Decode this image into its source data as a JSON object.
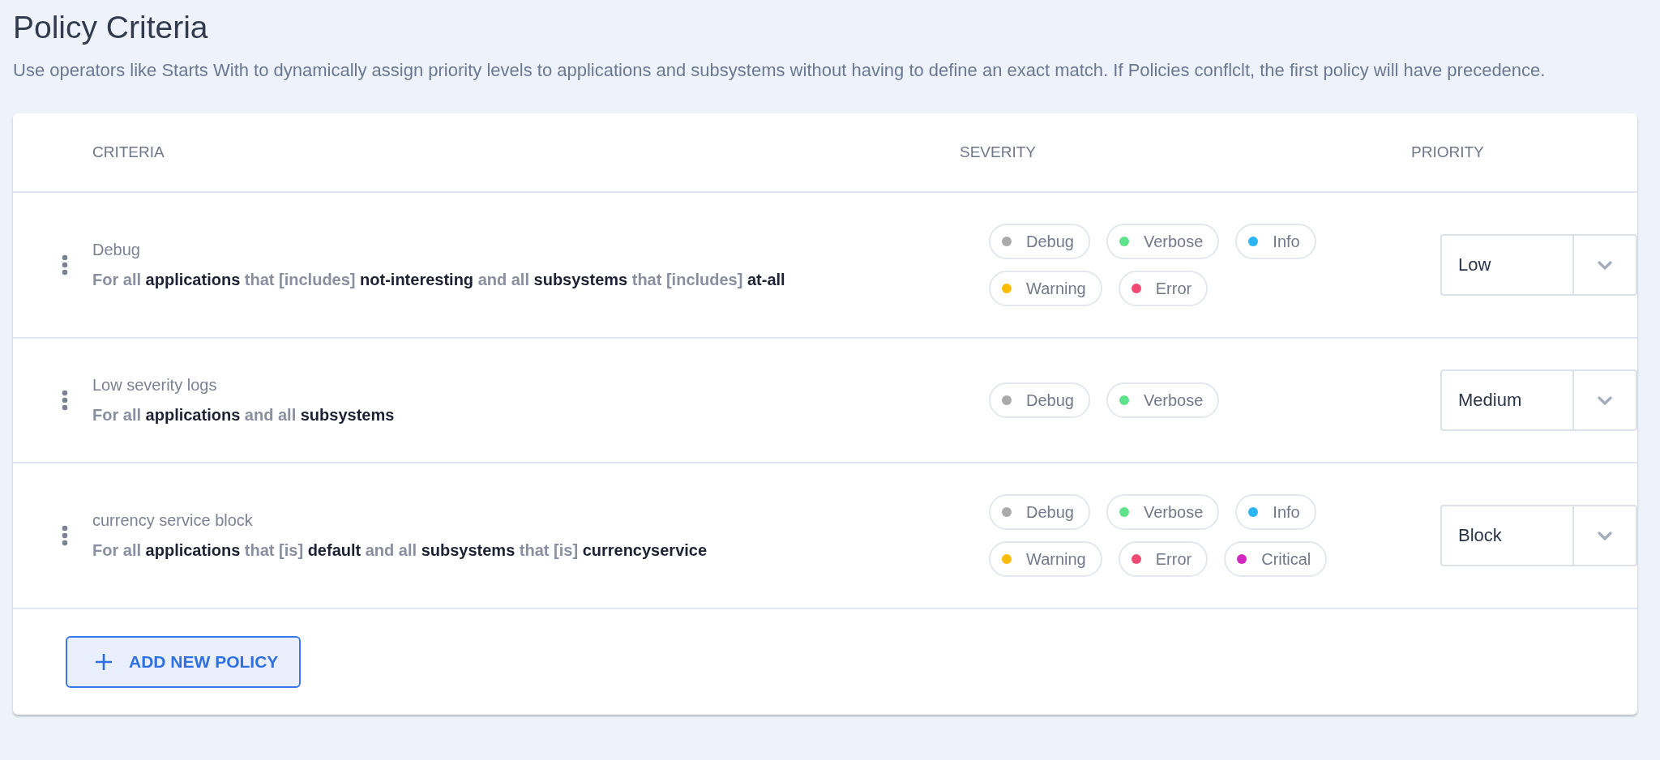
{
  "page": {
    "title": "Policy Criteria",
    "description": "Use operators like Starts With to dynamically assign priority levels to applications and subsystems without having to define an exact match. If Policies conflclt, the first policy will have precedence."
  },
  "table": {
    "columns": [
      "CRITERIA",
      "SEVERITY",
      "PRIORITY"
    ],
    "rows": [
      {
        "name": "Debug",
        "criteria": "For all **applications** that [includes] **not-interesting** and all **subsystems** that [includes] **at-all**",
        "severities": [
          {
            "label": "Debug",
            "color": "#aaaaaa"
          },
          {
            "label": "Verbose",
            "color": "#5ee38a"
          },
          {
            "label": "Info",
            "color": "#2bb5f2"
          },
          {
            "label": "Warning",
            "color": "#fbbc05"
          },
          {
            "label": "Error",
            "color": "#ef4a74"
          }
        ],
        "priority": "Low"
      },
      {
        "name": "Low severity logs",
        "criteria": "For all **applications** and all **subsystems**",
        "severities": [
          {
            "label": "Debug",
            "color": "#aaaaaa"
          },
          {
            "label": "Verbose",
            "color": "#5ee38a"
          }
        ],
        "priority": "Medium"
      },
      {
        "name": "currency service block",
        "criteria": "For all **applications** that [is] **default** and all **subsystems** that [is] **currencyservice**",
        "severities": [
          {
            "label": "Debug",
            "color": "#aaaaaa"
          },
          {
            "label": "Verbose",
            "color": "#5ee38a"
          },
          {
            "label": "Info",
            "color": "#2bb5f2"
          },
          {
            "label": "Warning",
            "color": "#fbbc05"
          },
          {
            "label": "Error",
            "color": "#ef4a74"
          },
          {
            "label": "Critical",
            "color": "#d22ac0"
          }
        ],
        "priority": "Block"
      }
    ]
  },
  "add_button": {
    "label": "ADD NEW POLICY"
  }
}
